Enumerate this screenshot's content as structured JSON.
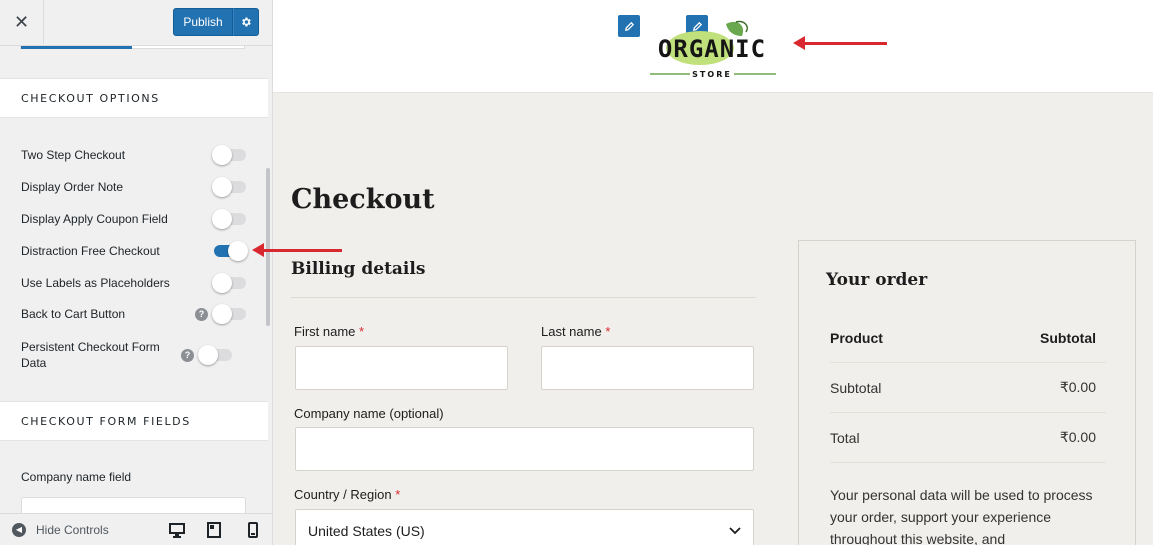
{
  "sidebar": {
    "close_icon": "✕",
    "publish_label": "Publish",
    "sections": {
      "checkout_options": "CHECKOUT OPTIONS",
      "checkout_form_fields": "CHECKOUT FORM FIELDS"
    },
    "options": [
      {
        "label": "Two Step Checkout",
        "on": false,
        "help": false
      },
      {
        "label": "Display Order Note",
        "on": false,
        "help": false
      },
      {
        "label": "Display Apply Coupon Field",
        "on": false,
        "help": false
      },
      {
        "label": "Distraction Free Checkout",
        "on": true,
        "help": false
      },
      {
        "label": "Use Labels as Placeholders",
        "on": false,
        "help": false
      },
      {
        "label": "Back to Cart Button",
        "on": false,
        "help": true
      },
      {
        "label": "Persistent Checkout Form Data",
        "on": false,
        "help": true
      }
    ],
    "company_field_label": "Company name field",
    "footer": {
      "hide_controls": "Hide Controls",
      "devices": [
        "desktop-icon",
        "tablet-icon",
        "mobile-icon"
      ]
    },
    "accent_color": "#2271b1"
  },
  "preview": {
    "logo": {
      "main": "ORGANIC",
      "sub": "STORE"
    },
    "page_title": "Checkout",
    "billing_title": "Billing details",
    "fields": {
      "first_name": "First name",
      "last_name": "Last name",
      "company": "Company name (optional)",
      "country": "Country / Region",
      "required_mark": "*",
      "country_value": "United States (US)"
    },
    "order": {
      "title": "Your order",
      "head_product": "Product",
      "head_subtotal": "Subtotal",
      "subtotal_label": "Subtotal",
      "subtotal_value": "₹0.00",
      "total_label": "Total",
      "total_value": "₹0.00",
      "privacy_text": "Your personal data will be used to process your order, support your experience throughout this website, and"
    },
    "annotation_color": "#d9282f"
  }
}
